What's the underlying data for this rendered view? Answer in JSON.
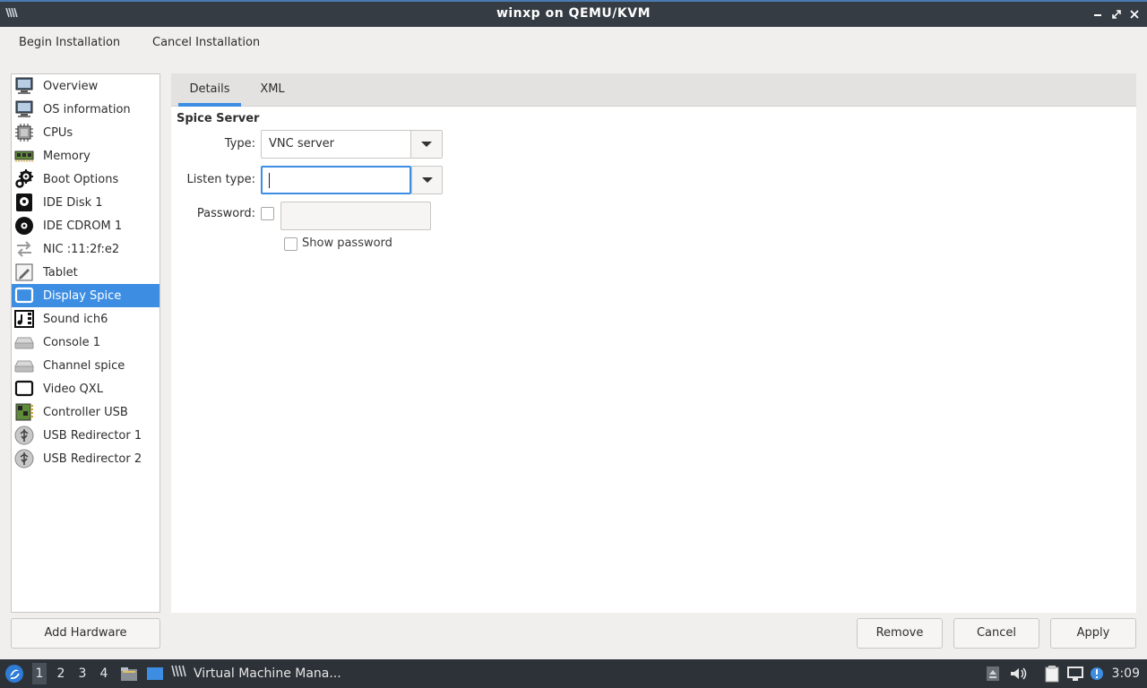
{
  "window": {
    "title": "winxp on QEMU/KVM",
    "app_icon": "virt-manager-icon"
  },
  "toolbar": {
    "begin_label": "Begin Installation",
    "cancel_label": "Cancel Installation"
  },
  "sidebar": {
    "items": [
      {
        "label": "Overview",
        "icon": "monitor-icon"
      },
      {
        "label": "OS information",
        "icon": "monitor-icon"
      },
      {
        "label": "CPUs",
        "icon": "cpu-icon"
      },
      {
        "label": "Memory",
        "icon": "memory-icon"
      },
      {
        "label": "Boot Options",
        "icon": "gears-icon"
      },
      {
        "label": "IDE Disk 1",
        "icon": "disk-icon"
      },
      {
        "label": "IDE CDROM 1",
        "icon": "cdrom-icon"
      },
      {
        "label": "NIC :11:2f:e2",
        "icon": "network-arrows-icon"
      },
      {
        "label": "Tablet",
        "icon": "tablet-icon"
      },
      {
        "label": "Display Spice",
        "icon": "display-icon"
      },
      {
        "label": "Sound ich6",
        "icon": "sound-icon"
      },
      {
        "label": "Console 1",
        "icon": "serial-icon"
      },
      {
        "label": "Channel spice",
        "icon": "serial-icon"
      },
      {
        "label": "Video QXL",
        "icon": "video-icon"
      },
      {
        "label": "Controller USB",
        "icon": "controller-icon"
      },
      {
        "label": "USB Redirector 1",
        "icon": "usb-icon"
      },
      {
        "label": "USB Redirector 2",
        "icon": "usb-icon"
      }
    ],
    "selected": "Display Spice"
  },
  "tabs": {
    "details": "Details",
    "xml": "XML",
    "active": "Details"
  },
  "form": {
    "section_title": "Spice Server",
    "type_label": "Type:",
    "type_value": "VNC server",
    "listen_label": "Listen type:",
    "listen_value": "",
    "password_label": "Password:",
    "password_value": "",
    "password_enabled": false,
    "show_password_label": "Show password",
    "show_password_checked": false
  },
  "buttons": {
    "add_hardware": "Add Hardware",
    "remove": "Remove",
    "cancel": "Cancel",
    "apply": "Apply"
  },
  "taskbar": {
    "workspaces": [
      "1",
      "2",
      "3",
      "4"
    ],
    "active_workspace": "1",
    "task_label": "Virtual Machine Mana...",
    "clock": "3:09"
  },
  "colors": {
    "accent": "#3d8ee3",
    "titlebar": "#363c44",
    "taskbar": "#2d3238"
  }
}
